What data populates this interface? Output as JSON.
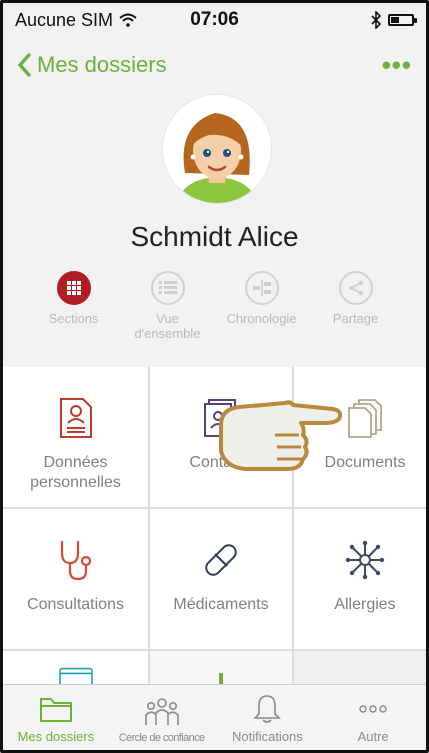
{
  "status_bar": {
    "carrier": "Aucune SIM",
    "time": "07:06"
  },
  "nav": {
    "back_label": "Mes dossiers",
    "more_label": "•••"
  },
  "profile": {
    "name": "Schmidt Alice"
  },
  "views": [
    {
      "label": "Sections",
      "icon": "grid-icon",
      "active": true
    },
    {
      "label": "Vue d'ensemble",
      "icon": "list-icon",
      "active": false
    },
    {
      "label": "Chronologie",
      "icon": "timeline-icon",
      "active": false
    },
    {
      "label": "Partage",
      "icon": "share-icon",
      "active": false
    }
  ],
  "tiles": [
    {
      "label": "Données personnelles",
      "icon": "personal-data-icon"
    },
    {
      "label": "Contacts",
      "icon": "contacts-icon"
    },
    {
      "label": "Documents",
      "icon": "documents-icon"
    },
    {
      "label": "Consultations",
      "icon": "stethoscope-icon"
    },
    {
      "label": "Médicaments",
      "icon": "pill-icon"
    },
    {
      "label": "Allergies",
      "icon": "allergy-icon"
    }
  ],
  "tabbar": [
    {
      "label": "Mes dossiers",
      "icon": "folder-icon",
      "active": true
    },
    {
      "label": "Cercle de confiance",
      "icon": "people-icon",
      "active": false
    },
    {
      "label": "Notifications",
      "icon": "bell-icon",
      "active": false
    },
    {
      "label": "Autre",
      "icon": "more-icon",
      "active": false
    }
  ],
  "colors": {
    "accent": "#6ab23a",
    "sections_active": "#b11c25",
    "personal_data": "#c0392b",
    "consultations": "#d64a3a",
    "medicaments": "#2c3e60",
    "allergies": "#3a4c6a",
    "contacts": "#5b3f7a"
  }
}
